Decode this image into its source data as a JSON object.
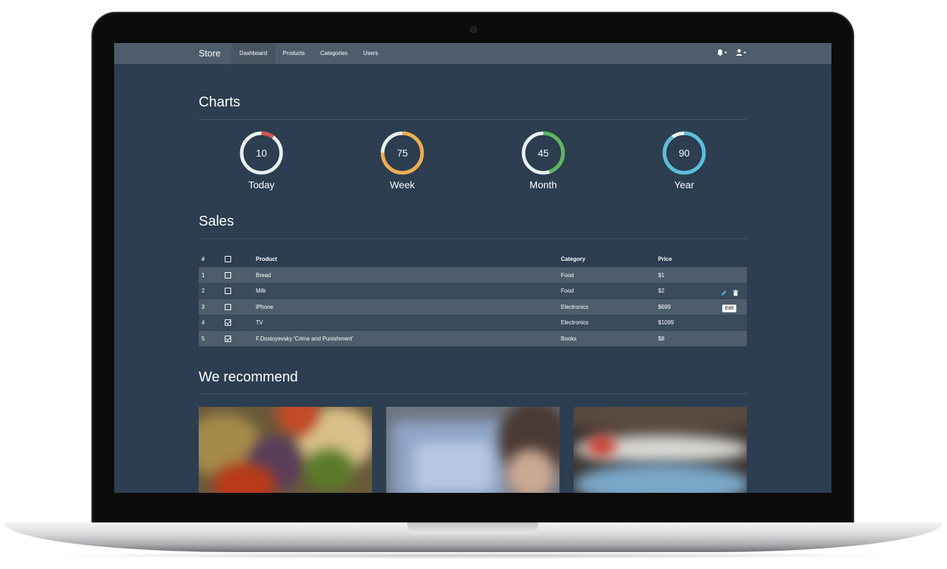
{
  "navbar": {
    "brand": "Store",
    "items": [
      {
        "label": "Dashboard",
        "active": true
      },
      {
        "label": "Products",
        "active": false
      },
      {
        "label": "Categories",
        "active": false
      },
      {
        "label": "Users",
        "active": false
      }
    ],
    "notifications_icon": "bell-icon",
    "user_icon": "user-icon"
  },
  "charts": {
    "title": "Charts",
    "track_color": "#ecf0f1",
    "gauges": [
      {
        "value": 10,
        "label": "Today",
        "percent": 10,
        "color": "#d9534f"
      },
      {
        "value": 75,
        "label": "Week",
        "percent": 75,
        "color": "#f0ad4e"
      },
      {
        "value": 45,
        "label": "Month",
        "percent": 45,
        "color": "#5cb85c"
      },
      {
        "value": 90,
        "label": "Year",
        "percent": 90,
        "color": "#5bc0de"
      }
    ]
  },
  "sales": {
    "title": "Sales",
    "headers": {
      "num": "#",
      "product": "Product",
      "category": "Category",
      "price": "Price"
    },
    "rows": [
      {
        "num": "1",
        "checked": false,
        "product": "Bread",
        "category": "Food",
        "price": "$1"
      },
      {
        "num": "2",
        "checked": false,
        "product": "Milk",
        "category": "Food",
        "price": "$2"
      },
      {
        "num": "3",
        "checked": false,
        "product": "iPhone",
        "category": "Electronics",
        "price": "$699"
      },
      {
        "num": "4",
        "checked": true,
        "product": "TV",
        "category": "Electronics",
        "price": "$1099"
      },
      {
        "num": "5",
        "checked": true,
        "product": "F.Dostoyevsky 'Crime and Punishment'",
        "category": "Books",
        "price": "$8"
      }
    ],
    "edit_icon": "pencil-icon",
    "delete_icon": "trash-icon",
    "tooltip": "Edit"
  },
  "recommend": {
    "title": "We recommend"
  }
}
